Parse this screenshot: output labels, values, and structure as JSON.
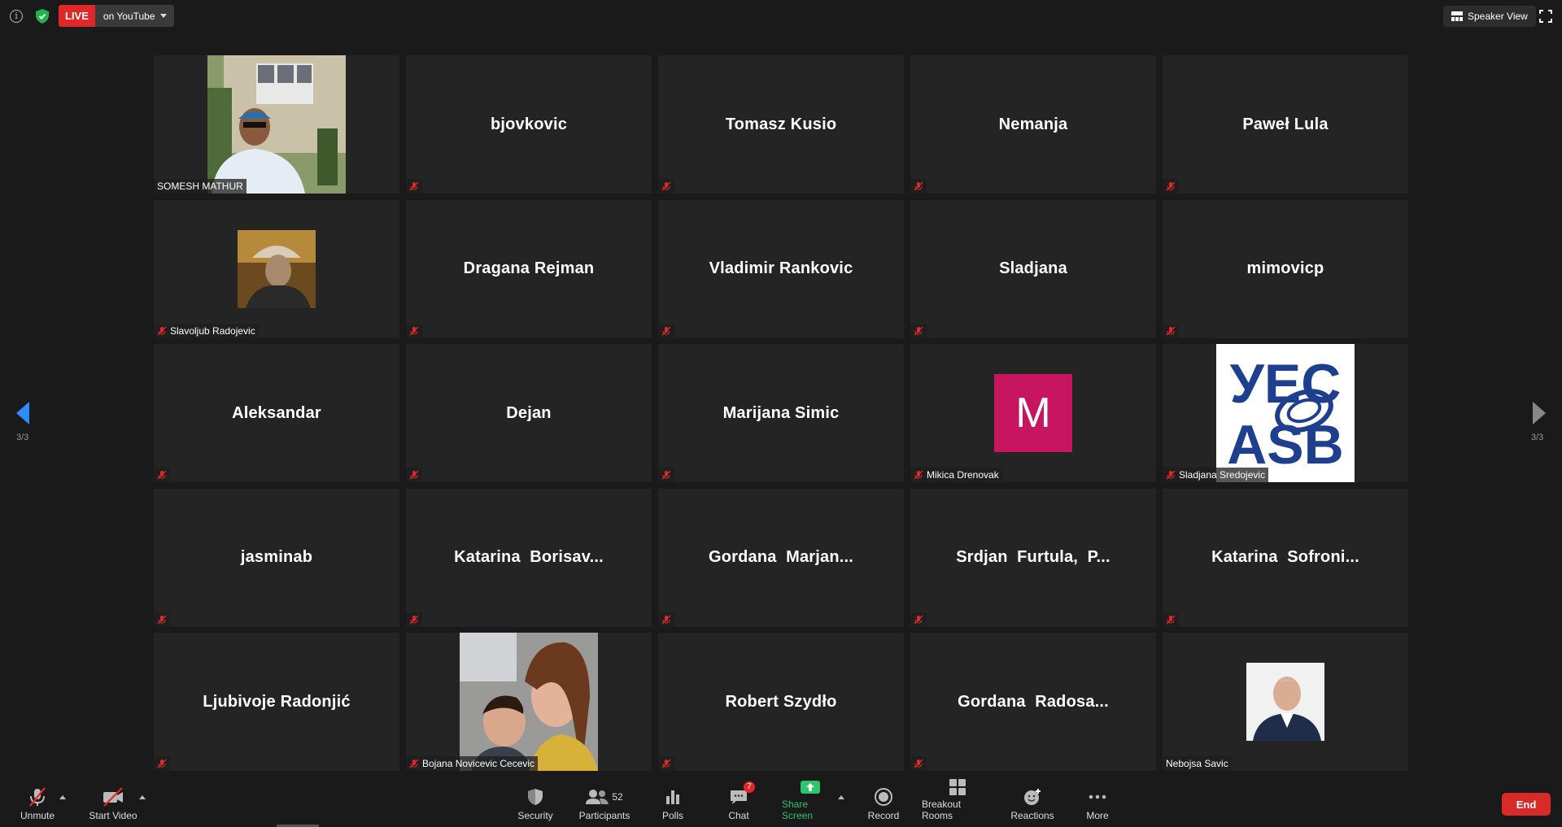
{
  "topbar": {
    "live_label": "LIVE",
    "live_destination": "on YouTube",
    "speaker_view_label": "Speaker View"
  },
  "tiles": [
    {
      "name": "SOMESH MATHUR",
      "type": "video",
      "muted": false
    },
    {
      "name": "bjovkovic",
      "type": "name",
      "muted": true
    },
    {
      "name": "Tomasz Kusio",
      "type": "name",
      "muted": true
    },
    {
      "name": "Nemanja",
      "type": "name",
      "muted": true
    },
    {
      "name": "Paweł Lula",
      "type": "name",
      "muted": true
    },
    {
      "name": "Slavoljub Radojevic",
      "type": "photo",
      "muted": true
    },
    {
      "name": "Dragana Rejman",
      "type": "name",
      "muted": true
    },
    {
      "name": "Vladimir Rankovic",
      "type": "name",
      "muted": true
    },
    {
      "name": "Sladjana",
      "type": "name",
      "muted": true
    },
    {
      "name": "mimovicp",
      "type": "name",
      "muted": true
    },
    {
      "name": "Aleksandar",
      "type": "name",
      "muted": true
    },
    {
      "name": "Dejan",
      "type": "name",
      "muted": true
    },
    {
      "name": "Marijana Simic",
      "type": "name",
      "muted": true
    },
    {
      "name": "Mikica Drenovak",
      "type": "letter",
      "letter": "M",
      "muted": true
    },
    {
      "name": "Sladjana Sredojevic",
      "type": "logo",
      "logo_top": "УЕС",
      "logo_bottom": "ASB",
      "muted": true
    },
    {
      "name": "jasminab",
      "type": "name",
      "muted": true
    },
    {
      "name": "Katarina  Borisav...",
      "type": "name",
      "muted": true
    },
    {
      "name": "Gordana  Marjan...",
      "type": "name",
      "muted": true
    },
    {
      "name": "Srdjan  Furtula,  P...",
      "type": "name",
      "muted": true
    },
    {
      "name": "Katarina  Sofroni...",
      "type": "name",
      "muted": true
    },
    {
      "name": "Ljubivoje Radonjić",
      "type": "name",
      "muted": true
    },
    {
      "name": "Bojana Novicevic Cecevic",
      "type": "video",
      "muted": true
    },
    {
      "name": "Robert Szydło",
      "type": "name",
      "muted": true
    },
    {
      "name": "Gordana  Radosa...",
      "type": "name",
      "muted": true
    },
    {
      "name": "Nebojsa Savic",
      "type": "photo",
      "muted": false
    }
  ],
  "pagination": {
    "left": "3/3",
    "right": "3/3"
  },
  "toolbar": {
    "unmute": "Unmute",
    "start_video": "Start Video",
    "security": "Security",
    "participants": "Participants",
    "participants_count": "52",
    "polls": "Polls",
    "chat": "Chat",
    "chat_badge": "7",
    "share_screen": "Share Screen",
    "record": "Record",
    "breakout_rooms": "Breakout Rooms",
    "reactions": "Reactions",
    "more": "More",
    "end": "End"
  },
  "colors": {
    "live_red": "#e02828",
    "share_green": "#2ec46a",
    "letter_avatar": "#c7155f",
    "logo_blue": "#1e3f8f",
    "nav_blue": "#2d8cff"
  }
}
